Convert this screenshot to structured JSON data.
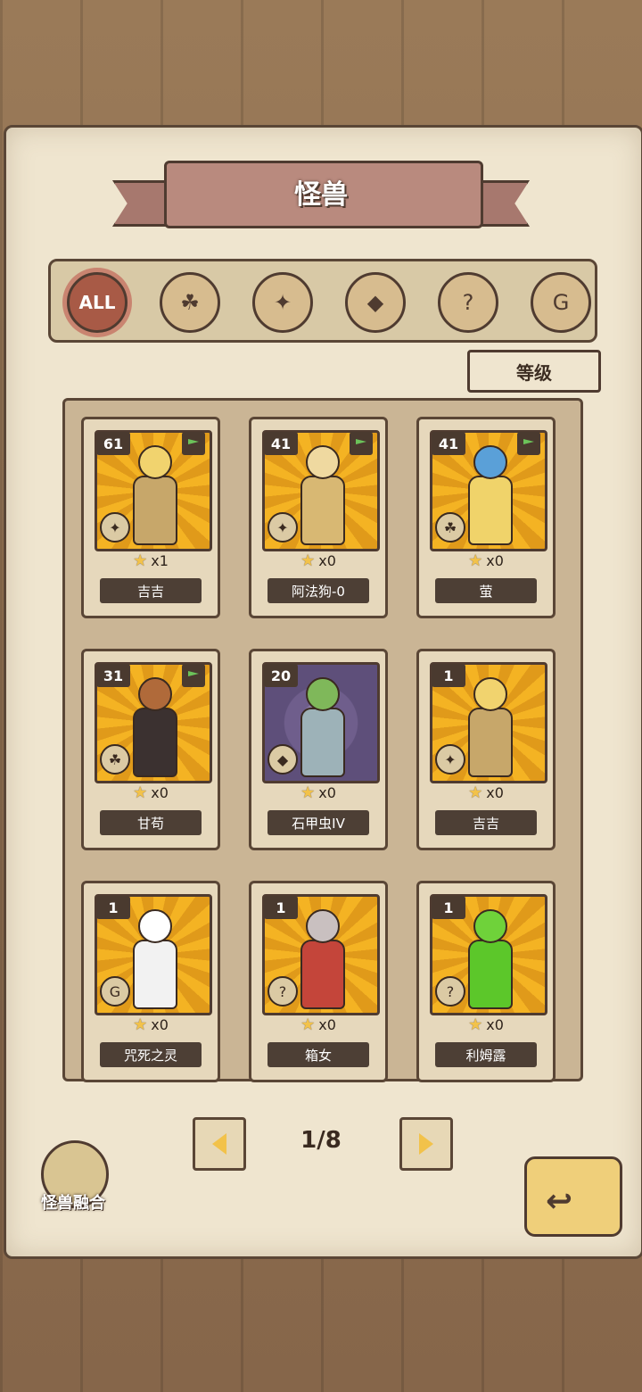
{
  "header": {
    "title": "怪兽"
  },
  "filters": [
    {
      "label": "ALL",
      "icon": "all-icon",
      "glyph": "ALL",
      "active": true
    },
    {
      "label": "",
      "icon": "clover-icon",
      "glyph": "☘",
      "active": false
    },
    {
      "label": "",
      "icon": "paw-icon",
      "glyph": "✦",
      "active": false
    },
    {
      "label": "",
      "icon": "crystal-icon",
      "glyph": "◆",
      "active": false
    },
    {
      "label": "",
      "icon": "question-icon",
      "glyph": "?",
      "active": false
    },
    {
      "label": "",
      "icon": "spiral-icon",
      "glyph": "G",
      "active": false
    }
  ],
  "sort": {
    "label": "等级"
  },
  "cards": [
    {
      "level": "61",
      "stars": "x1",
      "name": "吉吉",
      "bg": "yellow",
      "type_glyph": "✦",
      "type_icon": "paw-icon",
      "flag": true,
      "hair": "#f1d36e",
      "body": "#c7a76a"
    },
    {
      "level": "41",
      "stars": "x0",
      "name": "阿法狗-0",
      "bg": "yellow",
      "type_glyph": "✦",
      "type_icon": "paw-icon",
      "flag": true,
      "hair": "#efd9a0",
      "body": "#d8b873"
    },
    {
      "level": "41",
      "stars": "x0",
      "name": "萤",
      "bg": "yellow",
      "type_glyph": "☘",
      "type_icon": "clover-icon",
      "flag": true,
      "hair": "#5aa0d8",
      "body": "#f0d36a"
    },
    {
      "level": "31",
      "stars": "x0",
      "name": "甘苟",
      "bg": "yellow",
      "type_glyph": "☘",
      "type_icon": "clover-icon",
      "flag": true,
      "hair": "#b06a3a",
      "body": "#3b3130"
    },
    {
      "level": "20",
      "stars": "x0",
      "name": "石甲虫IV",
      "bg": "purple",
      "type_glyph": "◆",
      "type_icon": "crystal-icon",
      "flag": false,
      "hair": "#7fb85a",
      "body": "#9db2b8"
    },
    {
      "level": "1",
      "stars": "x0",
      "name": "吉吉",
      "bg": "yellow",
      "type_glyph": "✦",
      "type_icon": "paw-icon",
      "flag": false,
      "hair": "#f1d36e",
      "body": "#c7a76a"
    },
    {
      "level": "1",
      "stars": "x0",
      "name": "咒死之灵",
      "bg": "yellow",
      "type_glyph": "G",
      "type_icon": "spiral-icon",
      "flag": false,
      "hair": "#ffffff",
      "body": "#f2f2f2"
    },
    {
      "level": "1",
      "stars": "x0",
      "name": "箱女",
      "bg": "yellow",
      "type_glyph": "?",
      "type_icon": "question-icon",
      "flag": false,
      "hair": "#c9c0c0",
      "body": "#c4453a"
    },
    {
      "level": "1",
      "stars": "x0",
      "name": "利姆露",
      "bg": "yellow",
      "type_glyph": "?",
      "type_icon": "question-icon",
      "flag": false,
      "hair": "#6fd23a",
      "body": "#5cc72a"
    }
  ],
  "pagination": {
    "text": "1/8"
  },
  "fusion": {
    "label": "怪兽融合"
  },
  "colors": {
    "accent_yellow": "#f2c24a",
    "dark_brown": "#4f3b30",
    "paper": "#efe5cf"
  }
}
